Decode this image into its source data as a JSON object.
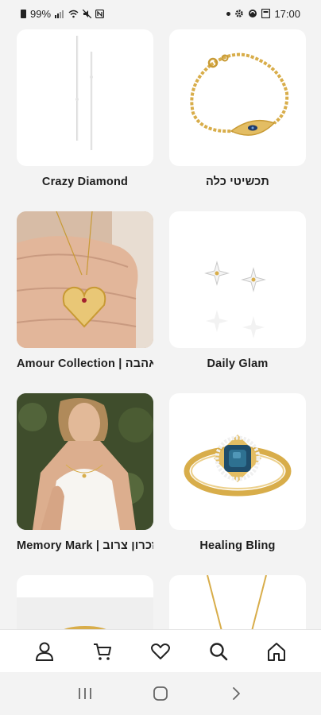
{
  "status_bar": {
    "battery": "99%",
    "time": "17:00",
    "icons": [
      "battery-icon",
      "signal-icon",
      "wifi-icon",
      "mute-icon",
      "nfc-icon",
      "notification-dot",
      "settings-icon",
      "sync-icon",
      "message-icon"
    ]
  },
  "collections": [
    {
      "title": "Crazy Diamond",
      "image": "drop-earrings-image"
    },
    {
      "title": "תכשיטי כלה",
      "image": "eye-bracelet-image"
    },
    {
      "title": "Amour Collection | אהבה",
      "image": "heart-necklace-image"
    },
    {
      "title": "Daily Glam",
      "image": "star-earrings-image"
    },
    {
      "title": "Memory Mark | זכרון צרוב",
      "image": "model-necklace-image"
    },
    {
      "title": "Healing Bling",
      "image": "blue-stone-ring-image"
    },
    {
      "title": "",
      "image": "gold-ring-image"
    },
    {
      "title": "",
      "image": "chain-necklace-image"
    }
  ],
  "bottom_nav": {
    "items": [
      "account-icon",
      "cart-icon",
      "wishlist-icon",
      "search-icon",
      "home-icon"
    ]
  },
  "system_nav": {
    "items": [
      "recent-apps-icon",
      "home-button-icon",
      "back-icon"
    ]
  },
  "colors": {
    "background": "#f3f3f3",
    "card": "#ffffff",
    "gold": "#d8ad4a",
    "text": "#1e1e1e"
  }
}
